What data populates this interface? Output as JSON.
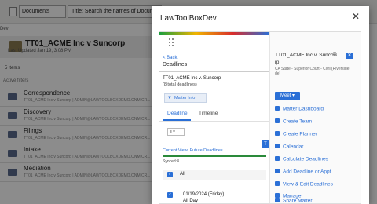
{
  "background": {
    "doc_type": "Documents",
    "search_placeholder": "Title: Search the names of Documents",
    "tiny_left": "Dev",
    "matter_title": "TT01_ACME Inc v Suncorp",
    "last_updated": "Last Updated Jan 19, 3:08 PM",
    "items_count": "5 items",
    "section_label": "Active filters",
    "folders": [
      {
        "name": "Correspondence",
        "path": "TT01_ACME Inc v Suncorp | ADMIN@LAWTOOLBOXDEMO.ONMICR..."
      },
      {
        "name": "Discovery",
        "path": "TT01_ACME Inc v Suncorp | ADMIN@LAWTOOLBOXDEMO.ONMICR..."
      },
      {
        "name": "Filings",
        "path": "TT01_ACME Inc v Suncorp | ADMIN@LAWTOOLBOXDEMO.ONMICR..."
      },
      {
        "name": "Intake",
        "path": "TT01_ACME Inc v Suncorp | ADMIN@LAWTOOLBOXDEMO.ONMICR..."
      },
      {
        "name": "Mediation",
        "path": "TT01_ACME Inc v Suncorp | ADMIN@LAWTOOLBOXDEMO.ONMICR..."
      }
    ]
  },
  "dialog": {
    "title": "LawToolBoxDev",
    "close_glyph": "✕"
  },
  "left": {
    "back": "< Back",
    "header": "Deadlines",
    "matter": "TT01_ACME Inc v. Suncorp",
    "count": "(8 total deadlines)",
    "matter_info": "Matter Info",
    "tabs": [
      "Deadline",
      "Timeline"
    ],
    "current_view": "Current View: Future Deadlines",
    "synced": "Synced:8",
    "all_label": "All",
    "item_date": "01/19/2024 (Friday)",
    "item_allday": "All Day",
    "trigger_badge": "TriggerDate"
  },
  "right": {
    "matter_line1": "TT01_ACME Inc v. Sunco",
    "matter_line2": "rp",
    "court1": "CA State - Superior Court - Civil (Riverside",
    "court2": "de)",
    "meet_label": "Meet ▾",
    "actions": [
      "Matter Dashboard",
      "Create Team",
      "Create Planner",
      "Calendar",
      "Calculate Deadlines",
      "Add Deadline or Appt",
      "View & Edit Deadlines",
      "Manage",
      "Share Matter"
    ]
  },
  "colors": {
    "accent": "#2a6fd6",
    "green": "#2a8a3a"
  }
}
